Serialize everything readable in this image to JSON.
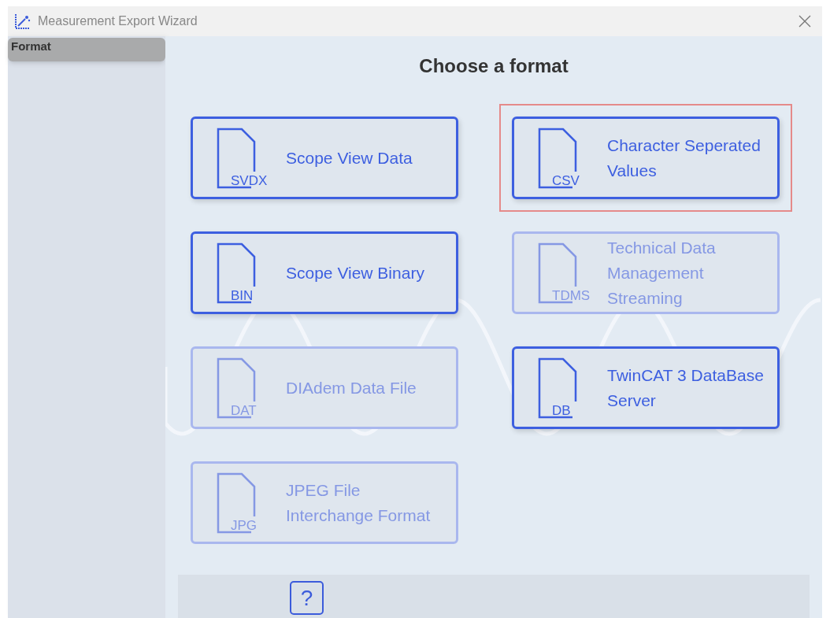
{
  "window": {
    "title": "Measurement Export Wizard"
  },
  "sidebar": {
    "items": [
      {
        "label": "Format",
        "selected": true
      }
    ]
  },
  "heading": "Choose a format",
  "formats": [
    {
      "label": "Scope View Data",
      "ext": "SVDX",
      "enabled": true,
      "selected": false
    },
    {
      "label": "Character Seperated Values",
      "ext": "CSV",
      "enabled": true,
      "selected": true
    },
    {
      "label": "Scope View Binary",
      "ext": "BIN",
      "enabled": true,
      "selected": false
    },
    {
      "label": "Technical Data Management Streaming",
      "ext": "TDMS",
      "enabled": false,
      "selected": false
    },
    {
      "label": "DIAdem Data File",
      "ext": "DAT",
      "enabled": false,
      "selected": false
    },
    {
      "label": "TwinCAT 3 DataBase Server",
      "ext": "DB",
      "enabled": true,
      "selected": false
    },
    {
      "label": "JPEG File Interchange Format",
      "ext": "JPG",
      "enabled": false,
      "selected": false
    }
  ],
  "help_button": "?"
}
